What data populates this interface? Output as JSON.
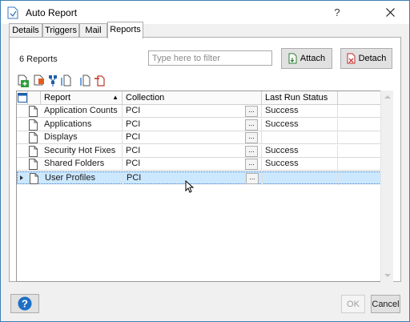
{
  "window": {
    "title": "Auto Report"
  },
  "tabs": [
    {
      "label": "Details",
      "active": false
    },
    {
      "label": "Triggers",
      "active": false
    },
    {
      "label": "Mail",
      "active": false
    },
    {
      "label": "Reports",
      "active": true
    }
  ],
  "reports_panel": {
    "count_label": "6 Reports",
    "filter": {
      "placeholder": "Type here to filter",
      "value": ""
    },
    "attach_label": "Attach",
    "detach_label": "Detach"
  },
  "toolbar": {
    "icons": [
      "new-report-icon",
      "remove-report-icon",
      "report-group-icon",
      "link-report-icon",
      "unlink-report-icon"
    ]
  },
  "grid": {
    "columns": {
      "report": "Report",
      "collection": "Collection",
      "last_run_status": "Last Run Status"
    },
    "sort": {
      "column": "Report",
      "direction": "ascending"
    },
    "ellipsis_label": "...",
    "rows": [
      {
        "report": "Application Counts",
        "collection": "PCI",
        "status": "Success",
        "selected": false
      },
      {
        "report": "Applications",
        "collection": "PCI",
        "status": "Success",
        "selected": false
      },
      {
        "report": "Displays",
        "collection": "PCI",
        "status": "",
        "selected": false
      },
      {
        "report": "Security Hot Fixes",
        "collection": "PCI",
        "status": "Success",
        "selected": false
      },
      {
        "report": "Shared Folders",
        "collection": "PCI",
        "status": "Success",
        "selected": false
      },
      {
        "report": "User Profiles",
        "collection": "PCI",
        "status": "",
        "selected": true
      }
    ]
  },
  "footer": {
    "help_label": "?",
    "ok_label": "OK",
    "cancel_label": "Cancel"
  },
  "colors": {
    "accent": "#0078d7",
    "selection": "#cce8ff",
    "help_button": "#1e6fc4"
  }
}
